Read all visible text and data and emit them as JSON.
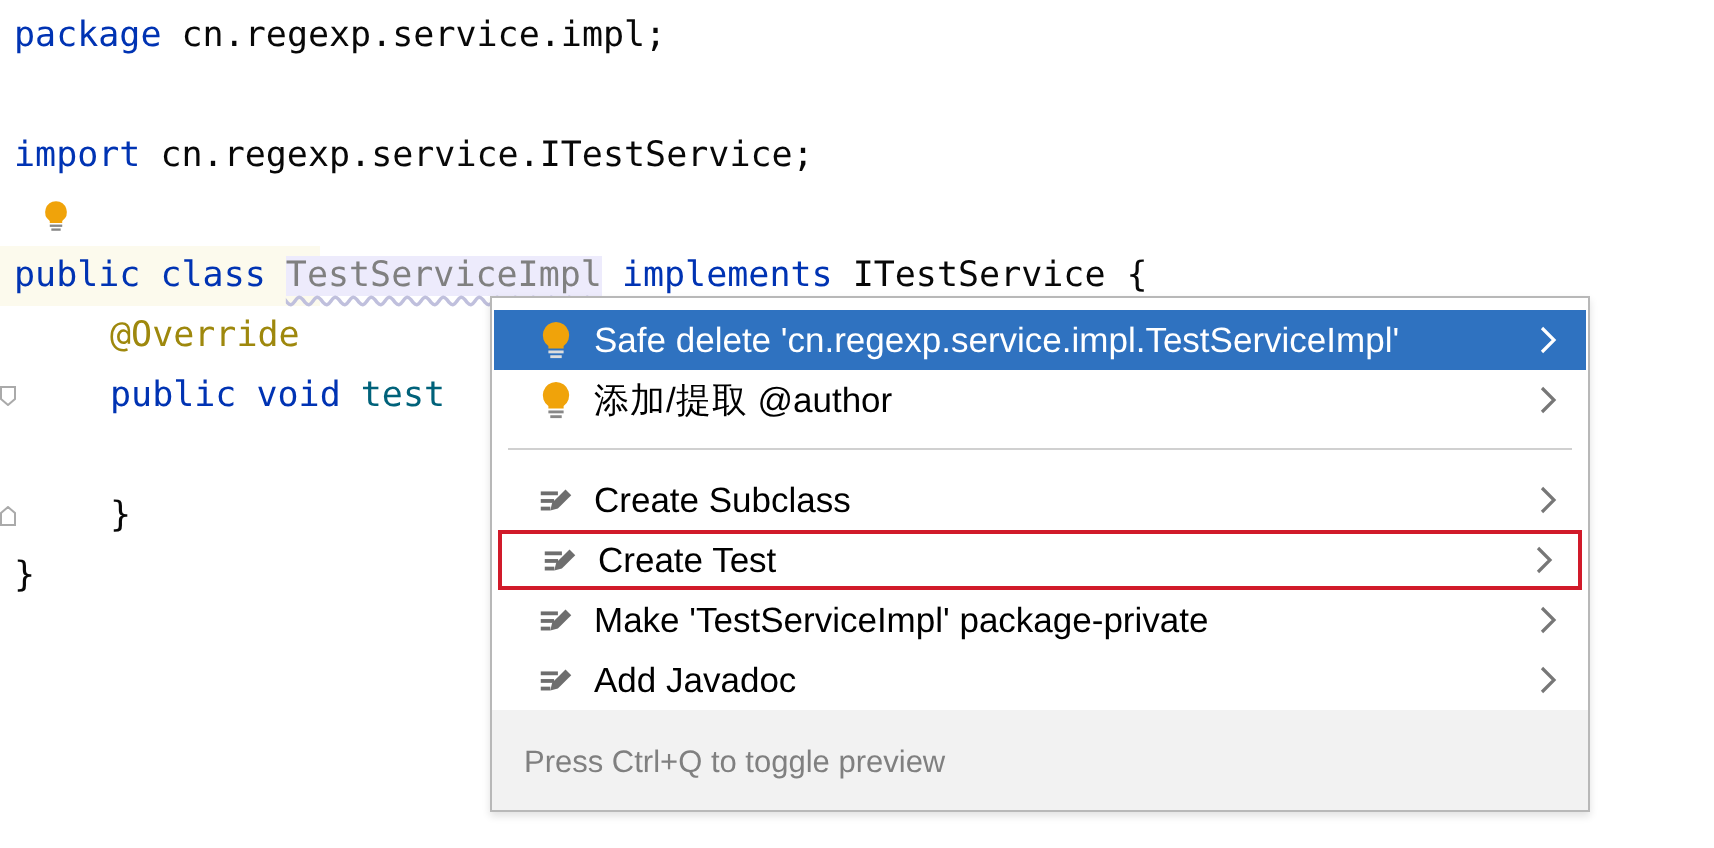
{
  "editor": {
    "lines": [
      {
        "tokens": [
          {
            "text": "package",
            "kind": "keyword"
          },
          {
            "text": "cn.regexp.service.impl;",
            "kind": "plain"
          }
        ]
      },
      {
        "kind": "blank"
      },
      {
        "tokens": [
          {
            "text": "import",
            "kind": "keyword"
          },
          {
            "text": "cn.regexp.service.ITestService;",
            "kind": "plain"
          }
        ]
      },
      {
        "bulb": true
      },
      {
        "tokens": [
          {
            "text": "public",
            "kind": "keyword"
          },
          {
            "text": "class",
            "kind": "keyword"
          },
          {
            "text": "TestServiceImpl",
            "kind": "unused"
          },
          {
            "text": "implements",
            "kind": "keyword"
          },
          {
            "text": "ITestService {",
            "kind": "plain"
          }
        ],
        "current": true
      },
      {
        "tokens": [
          {
            "text": "@Override",
            "kind": "annotation"
          }
        ],
        "indented": true
      },
      {
        "tokens": [
          {
            "text": "public",
            "kind": "keyword"
          },
          {
            "text": "void",
            "kind": "keyword"
          },
          {
            "text": "test",
            "kind": "method"
          }
        ],
        "indented": true,
        "kind": "fold-start"
      },
      {
        "kind": "blank"
      },
      {
        "tokens": [
          {
            "text": "}",
            "kind": "plain"
          }
        ],
        "indented": true,
        "kind": "fold-end"
      },
      {
        "tokens": [
          {
            "text": "}",
            "kind": "plain"
          }
        ]
      }
    ]
  },
  "popup": {
    "items": [
      {
        "label": "Safe delete 'cn.regexp.service.impl.TestServiceImpl'",
        "kind": "quickfix",
        "selected": true,
        "outlined": false
      },
      {
        "label": "添加/提取 @author",
        "kind": "quickfix",
        "selected": false,
        "outlined": false
      },
      {
        "kind": "separator"
      },
      {
        "label": "Create Subclass",
        "kind": "intention",
        "selected": false,
        "outlined": false
      },
      {
        "label": "Create Test",
        "kind": "intention",
        "selected": false,
        "outlined": true
      },
      {
        "label": "Make 'TestServiceImpl' package-private",
        "kind": "intention",
        "selected": false,
        "outlined": false
      },
      {
        "label": "Add Javadoc",
        "kind": "intention",
        "selected": false,
        "outlined": false
      }
    ],
    "footer": "Press Ctrl+Q to toggle preview"
  }
}
